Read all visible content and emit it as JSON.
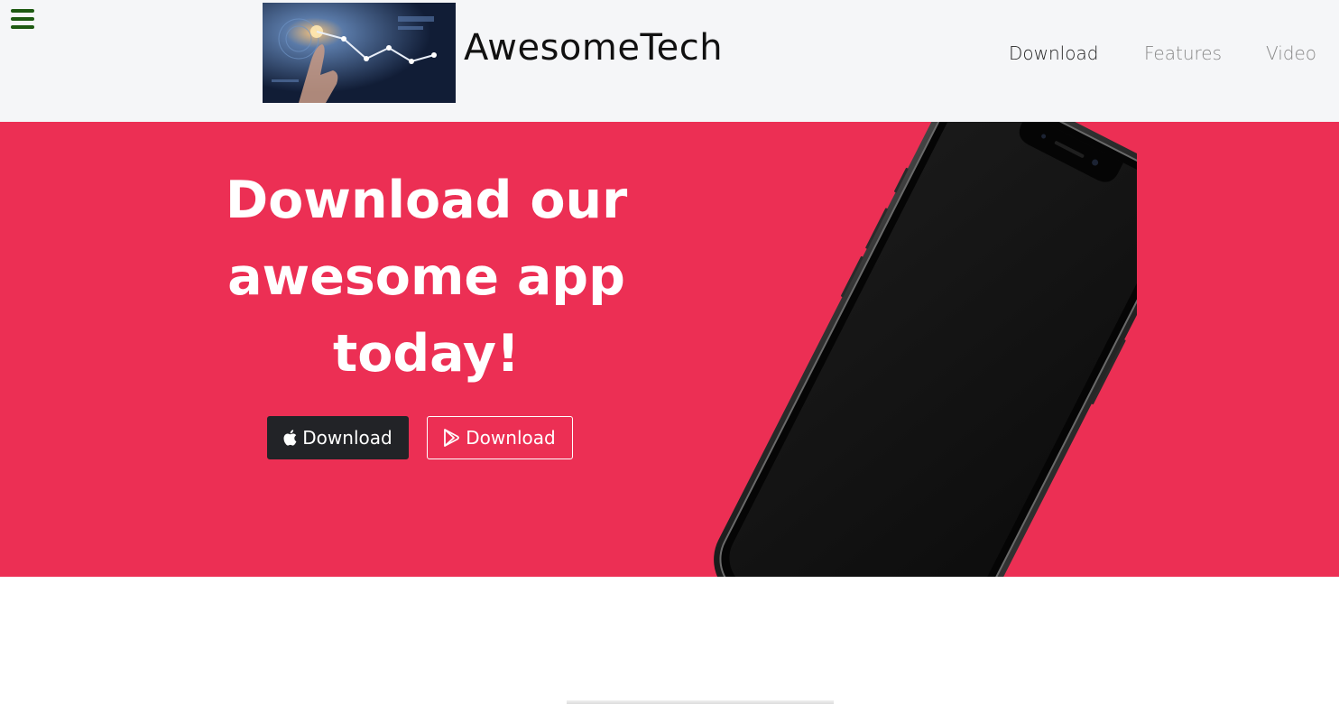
{
  "navbar": {
    "brand_name": "AwesomeTech",
    "links": [
      "Download",
      "Features",
      "Video"
    ],
    "active_link": "Download"
  },
  "hero": {
    "headline_lines": [
      "Download our",
      "awesome app",
      "today!"
    ],
    "buttons": {
      "apple_label": "Download",
      "play_label": "Download"
    }
  },
  "icons": {
    "menu": "hamburger-icon",
    "apple": "apple-icon",
    "play": "google-play-icon"
  },
  "colors": {
    "hero_bg": "#ec2f54",
    "navbar_bg": "#f5f6f8",
    "hamburger": "#1e5a12",
    "apple_button_bg": "#222327"
  }
}
